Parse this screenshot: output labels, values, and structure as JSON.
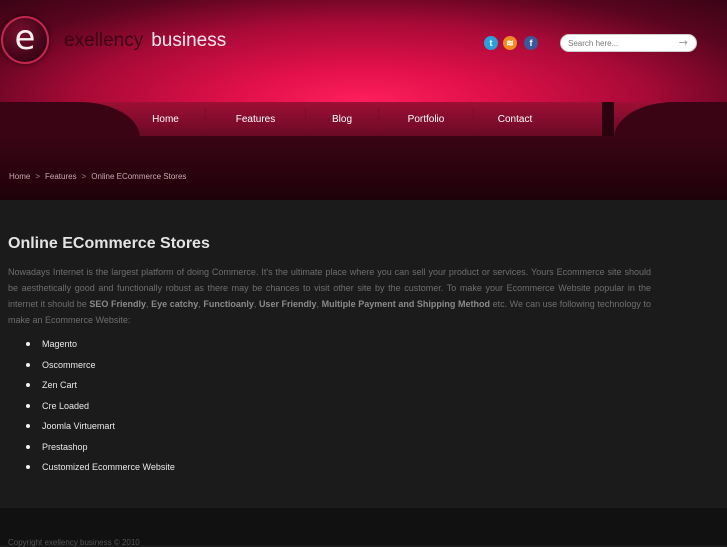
{
  "brand": {
    "logo_letter": "e",
    "name_dark": "exellency",
    "name_light": "business"
  },
  "social": [
    {
      "icon": "twitter-icon",
      "glyph": "t",
      "color": "#2a9fd8"
    },
    {
      "icon": "rss-icon",
      "glyph": "≋",
      "color": "#f08a24"
    },
    {
      "icon": "facebook-icon",
      "glyph": "f",
      "color": "#3b5998"
    }
  ],
  "search": {
    "placeholder": "Search here...",
    "submit_glyph": "→"
  },
  "nav": {
    "home": "Home",
    "features": "Features",
    "blog": "Blog",
    "portfolio": "Portfolio",
    "contact": "Contact"
  },
  "breadcrumb": {
    "home": "Home",
    "sep": ">",
    "features": "Features",
    "current": "Online ECommerce Stores"
  },
  "page": {
    "title": "Online ECommerce Stores",
    "intro_1": "Nowadays Internet is the largest platform of doing Commerce. It's the ultimate place where you can sell your product or services. Yours Ecommerce site should be aesthetically good and functionally robust as there may be chances to visit other site by the customer. To make your Ecommerce Website popular in the internet it should be",
    "kw_1": "SEO Friendly",
    "kw_2": "Eye catchy",
    "kw_3": "Functioanly",
    "kw_4": "User Friendly",
    "kw_5": "Multiple Payment and Shipping Method",
    "intro_2": "etc. We can use following technology to make an Ecommerce Website:",
    "items": [
      "Magento",
      "Oscommerce",
      "Zen Cart",
      "Cre Loaded",
      "Joomla Virtuemart",
      "Prestashop",
      "Customized Ecommerce Website"
    ]
  },
  "footer": {
    "copyright": "Copyright exellency business © 2010"
  },
  "colors": {
    "accent": "#e0104a",
    "dark": "#1b1b1b"
  }
}
